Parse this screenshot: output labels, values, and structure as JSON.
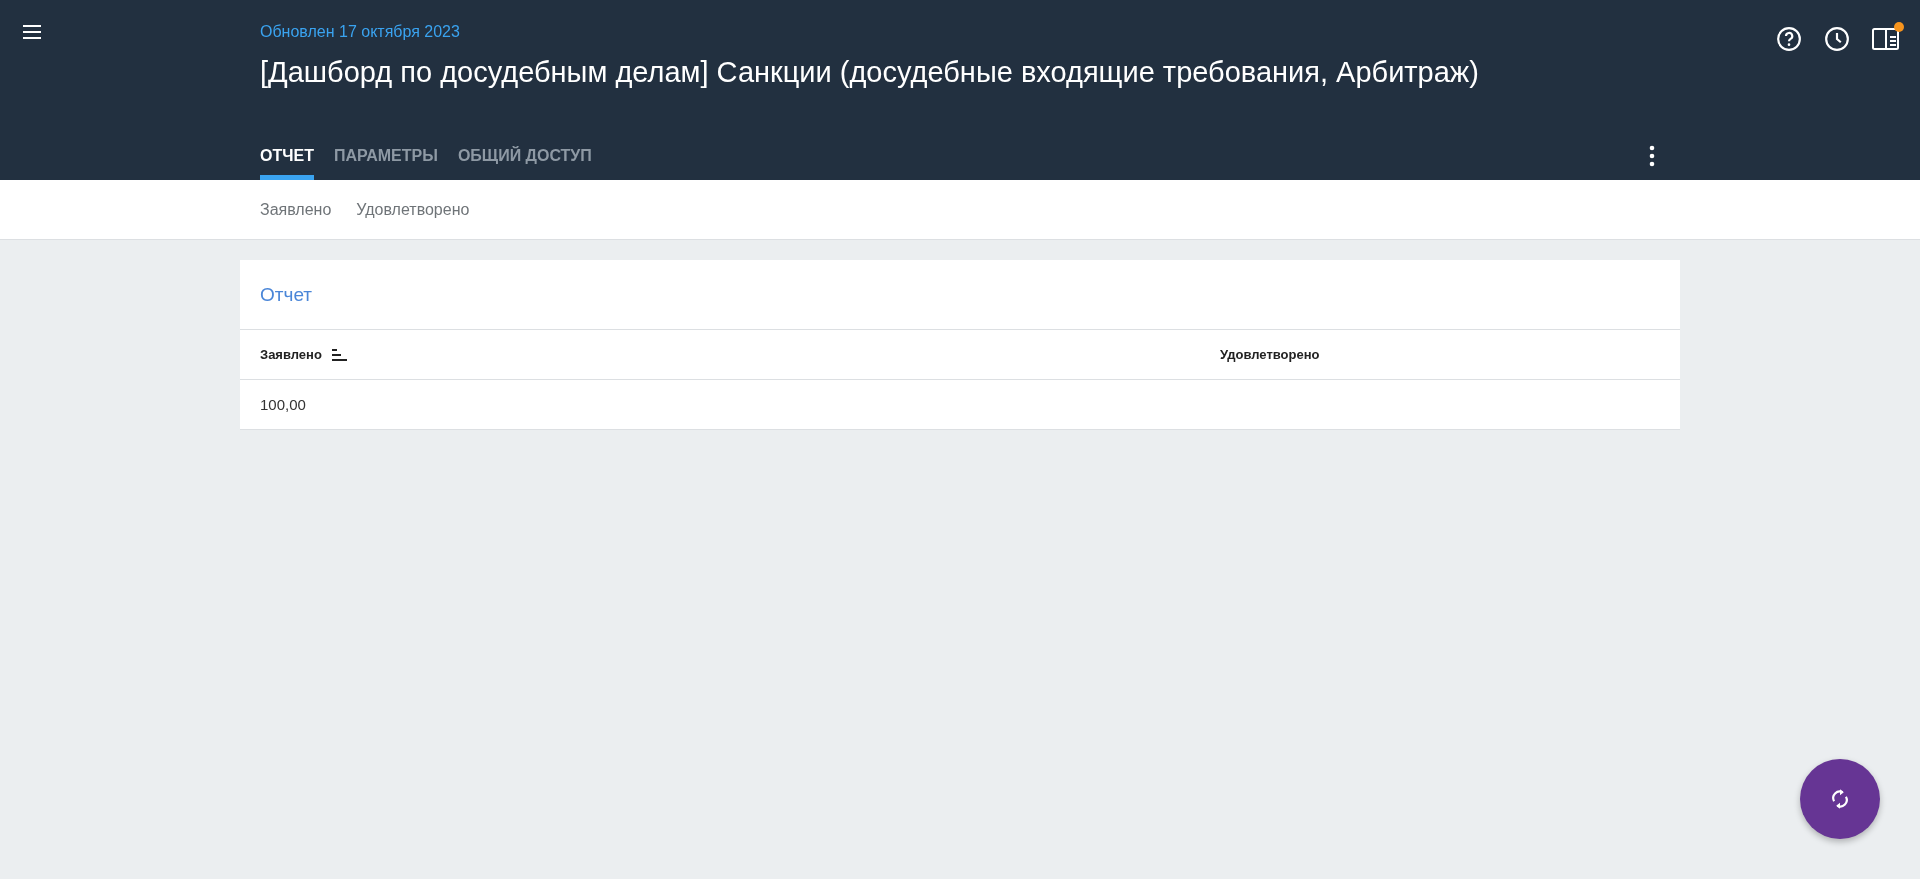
{
  "header": {
    "updated": "Обновлен 17 октября 2023",
    "title": "[Дашборд по досудебным делам] Санкции (досудебные входящие требования, Арбитраж)",
    "notification_dot": true
  },
  "tabs": [
    {
      "label": "ОТЧЕТ",
      "selected": true
    },
    {
      "label": "ПАРАМЕТРЫ",
      "selected": false
    },
    {
      "label": "ОБЩИЙ ДОСТУП",
      "selected": false
    }
  ],
  "filters": [
    "Заявлено",
    "Удовлетворено"
  ],
  "report": {
    "title": "Отчет",
    "columns": [
      {
        "label": "Заявлено",
        "sorted": true
      },
      {
        "label": "Удовлетворено",
        "sorted": false
      }
    ],
    "rows": [
      [
        "100,00",
        ""
      ]
    ]
  }
}
